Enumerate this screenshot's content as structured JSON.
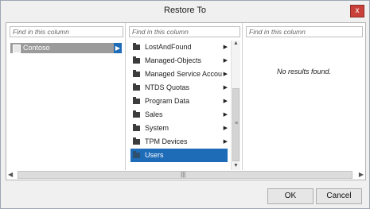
{
  "window": {
    "title": "Restore To",
    "close_label": "x"
  },
  "columns": [
    {
      "search_placeholder": "Find in this column",
      "selected_item": "Contoso"
    },
    {
      "search_placeholder": "Find in this column",
      "items": [
        {
          "label": "LostAndFound",
          "has_children": true
        },
        {
          "label": "Managed-Objects",
          "has_children": true
        },
        {
          "label": "Managed Service Accou",
          "has_children": true
        },
        {
          "label": "NTDS Quotas",
          "has_children": true
        },
        {
          "label": "Program Data",
          "has_children": true
        },
        {
          "label": "Sales",
          "has_children": true
        },
        {
          "label": "System",
          "has_children": true
        },
        {
          "label": "TPM Devices",
          "has_children": true
        },
        {
          "label": "Users",
          "has_children": false,
          "selected": true
        }
      ]
    },
    {
      "search_placeholder": "Find in this column",
      "empty_message": "No results found."
    }
  ],
  "buttons": {
    "ok": "OK",
    "cancel": "Cancel"
  },
  "icons": {
    "arrow": "▶",
    "scroll_up": "▲",
    "scroll_down": "▼",
    "scroll_left": "◀",
    "scroll_right": "▶",
    "grip_v": "≡",
    "grip_h": "|||"
  }
}
